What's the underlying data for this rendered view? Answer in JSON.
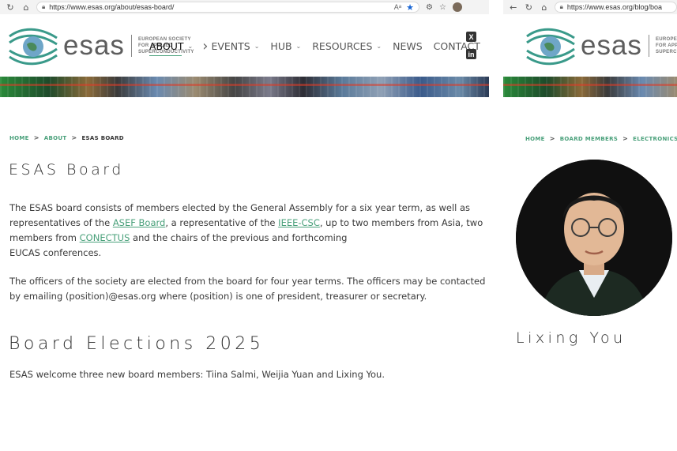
{
  "left_window": {
    "url": "https://www.esas.org/about/esas-board/",
    "logo": {
      "word": "esas",
      "sub_lines": [
        "EUROPEAN SOCIETY",
        "FOR APPLIED",
        "SUPERCONDUCTIVITY"
      ]
    },
    "nav": [
      {
        "label": "ABOUT",
        "has_dropdown": true
      },
      {
        "label": "EVENTS",
        "has_dropdown": true
      },
      {
        "label": "HUB",
        "has_dropdown": true
      },
      {
        "label": "RESOURCES",
        "has_dropdown": true
      },
      {
        "label": "NEWS",
        "has_dropdown": false
      },
      {
        "label": "CONTACT",
        "has_dropdown": false
      }
    ],
    "social": {
      "x": "X",
      "linkedin": "in"
    },
    "breadcrumb": {
      "home": "HOME",
      "about": "ABOUT",
      "current": "ESAS BOARD",
      "sep": ">"
    },
    "page_title": "ESAS Board",
    "paragraph1": {
      "t1": "The ESAS board consists of members elected by the General Assembly for a six year term, as well as representatives of the ",
      "link1": "ASEF Board",
      "t2": ", a representative of the ",
      "link2": "IEEE-CSC",
      "t3": ", up to two members from Asia, two members from ",
      "link3": "CONECTUS",
      "t4": " and the chairs of the previous and forthcoming",
      "t5": "EUCAS conferences."
    },
    "paragraph2": "The officers of the society are elected from the board for four year terms. The officers may be contacted by emailing (position)@esas.org where (position) is one of president, treasurer or secretary.",
    "section_title": "Board Elections 2025",
    "paragraph3": "ESAS welcome three new board members: Tiina Salmi, Weijia Yuan and Lixing You."
  },
  "right_window": {
    "url": "https://www.esas.org/blog/boa",
    "logo": {
      "word": "esas",
      "sub_lines": [
        "EUROPEA",
        "FOR APP",
        "SUPERCO"
      ]
    },
    "breadcrumb": {
      "home": "HOME",
      "board_members": "BOARD MEMBERS",
      "electronics": "ELECTRONICS",
      "sep": ">"
    },
    "person_name": "Lixing You"
  },
  "colors": {
    "accent_green": "#49a07a",
    "logo_teal": "#3a9a8a",
    "text": "#333333"
  },
  "icons": [
    "back-icon",
    "refresh-icon",
    "home-icon",
    "lock-icon",
    "read-aloud-icon",
    "favorite-star-icon",
    "extensions-icon",
    "favorites-icon",
    "profile-avatar",
    "x-icon",
    "linkedin-icon"
  ]
}
